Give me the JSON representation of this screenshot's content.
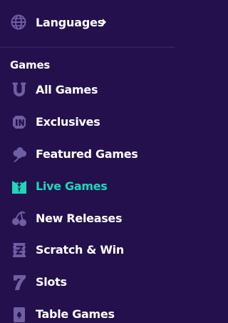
{
  "languages": {
    "label": "Languages"
  },
  "section": {
    "title": "Games"
  },
  "colors": {
    "background": "#23104d",
    "icon": "#6f5ea3",
    "active": "#1ed7b9",
    "text": "#ffffff",
    "divider": "#2f1f5e"
  },
  "nav": {
    "items": [
      {
        "label": "All Games",
        "icon": "horseshoe-icon",
        "active": false
      },
      {
        "label": "Exclusives",
        "icon": "exclusive-badge-icon",
        "active": false
      },
      {
        "label": "Featured Games",
        "icon": "clover-icon",
        "active": false
      },
      {
        "label": "Live Games",
        "icon": "live-dealer-icon",
        "active": true
      },
      {
        "label": "New Releases",
        "icon": "cherries-icon",
        "active": false
      },
      {
        "label": "Scratch & Win",
        "icon": "scratch-card-icon",
        "active": false
      },
      {
        "label": "Slots",
        "icon": "seven-icon",
        "active": false
      },
      {
        "label": "Table Games",
        "icon": "playing-card-icon",
        "active": false
      }
    ]
  }
}
